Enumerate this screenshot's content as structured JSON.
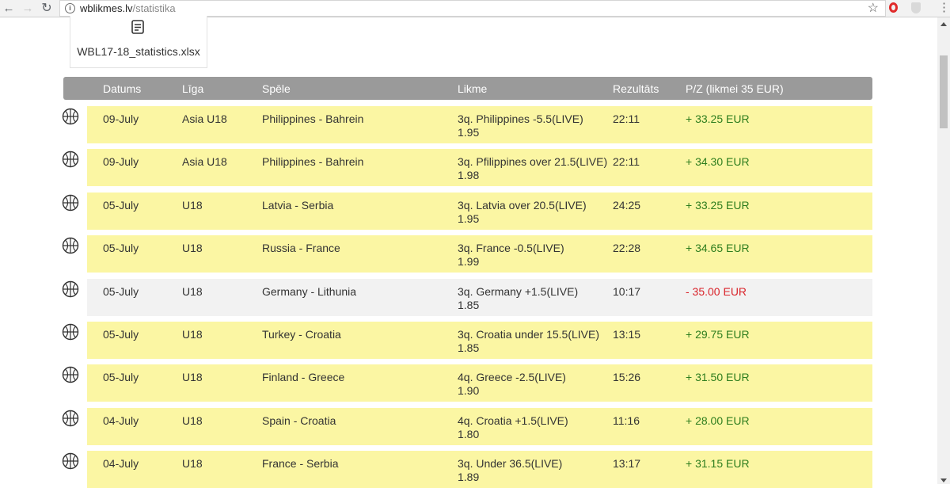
{
  "browser": {
    "url_host": "wblikmes.lv",
    "url_path": "/statistika",
    "icons": [
      "back-arrow-icon",
      "forward-arrow-icon",
      "reload-icon",
      "info-icon",
      "star-icon",
      "opera-icon",
      "shield-icon",
      "menu-icon"
    ]
  },
  "file": {
    "name": "WBL17-18_statistics.xlsx",
    "icon": "document-icon"
  },
  "table": {
    "headers": {
      "date": "Datums",
      "league": "Līga",
      "game": "Spēle",
      "bet": "Likme",
      "result": "Rezultāts",
      "pz": "P/Z (likmei 35 EUR)"
    },
    "row_colors": {
      "win": "#fbf6a3",
      "loss": "#f2f2f2"
    },
    "value_colors": {
      "positive": "#2e7d1e",
      "negative": "#d9232a"
    },
    "rows": [
      {
        "date": "09-July",
        "league": "Asia U18",
        "game": "Philippines - Bahrein",
        "bet": "3q. Philippines -5.5(LIVE)",
        "odds": "1.95",
        "result": "22:11",
        "pz": "+ 33.25 EUR",
        "outcome": "win"
      },
      {
        "date": "09-July",
        "league": "Asia U18",
        "game": "Philippines - Bahrein",
        "bet": "3q. Pfilippines over 21.5(LIVE)",
        "odds": "1.98",
        "result": "22:11",
        "pz": "+ 34.30 EUR",
        "outcome": "win"
      },
      {
        "date": "05-July",
        "league": "U18",
        "game": "Latvia - Serbia",
        "bet": "3q. Latvia over 20.5(LIVE)",
        "odds": "1.95",
        "result": "24:25",
        "pz": "+ 33.25 EUR",
        "outcome": "win"
      },
      {
        "date": "05-July",
        "league": "U18",
        "game": "Russia - France",
        "bet": "3q. France -0.5(LIVE)",
        "odds": "1.99",
        "result": "22:28",
        "pz": "+ 34.65 EUR",
        "outcome": "win"
      },
      {
        "date": "05-July",
        "league": "U18",
        "game": "Germany - Lithunia",
        "bet": "3q. Germany +1.5(LIVE)",
        "odds": "1.85",
        "result": "10:17",
        "pz": "- 35.00 EUR",
        "outcome": "loss"
      },
      {
        "date": "05-July",
        "league": "U18",
        "game": "Turkey - Croatia",
        "bet": "3q. Croatia under 15.5(LIVE)",
        "odds": "1.85",
        "result": "13:15",
        "pz": "+ 29.75 EUR",
        "outcome": "win"
      },
      {
        "date": "05-July",
        "league": "U18",
        "game": "Finland - Greece",
        "bet": "4q. Greece -2.5(LIVE)",
        "odds": "1.90",
        "result": "15:26",
        "pz": "+ 31.50 EUR",
        "outcome": "win"
      },
      {
        "date": "04-July",
        "league": "U18",
        "game": "Spain - Croatia",
        "bet": "4q. Croatia +1.5(LIVE)",
        "odds": "1.80",
        "result": "11:16",
        "pz": "+ 28.00 EUR",
        "outcome": "win"
      },
      {
        "date": "04-July",
        "league": "U18",
        "game": "France - Serbia",
        "bet": "3q. Under 36.5(LIVE)",
        "odds": "1.89",
        "result": "13:17",
        "pz": "+ 31.15 EUR",
        "outcome": "win"
      }
    ],
    "row_icon": "basketball-icon"
  }
}
